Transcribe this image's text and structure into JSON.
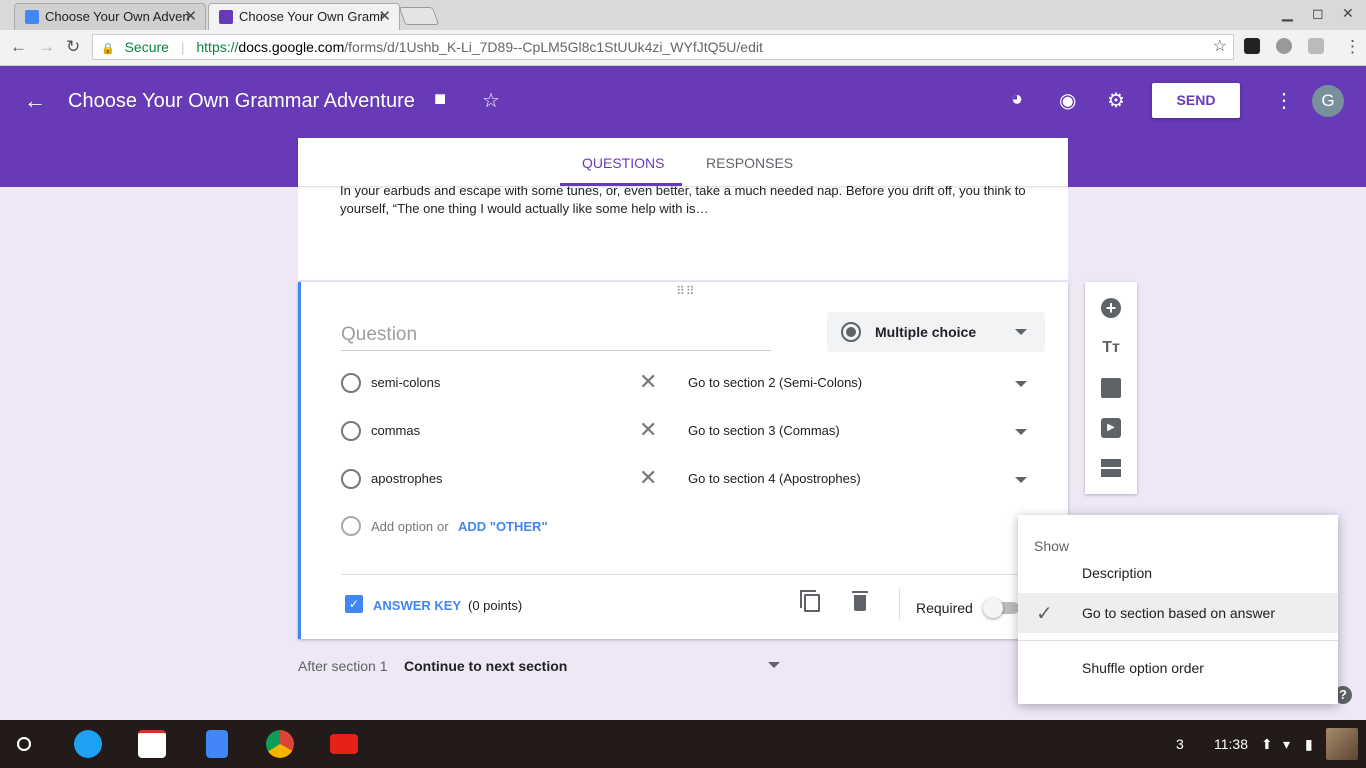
{
  "browser": {
    "tabs": [
      {
        "title": "Choose Your Own Adven",
        "active": false
      },
      {
        "title": "Choose Your Own Gramr",
        "active": true
      }
    ],
    "close_glyph": "✕",
    "secure_label": "Secure",
    "url_scheme": "https://",
    "url_host": "docs.google.com",
    "url_path": "/forms/d/1Ushb_K-Li_7D89--CpLM5Gl8c1StUUk4zi_WYfJtQ5U/edit"
  },
  "header": {
    "title": "Choose Your Own Grammar Adventure",
    "send_label": "SEND",
    "avatar_initial": "G",
    "accent": "#673ab7"
  },
  "tabs": {
    "questions": "QUESTIONS",
    "responses": "RESPONSES"
  },
  "description": {
    "text": "In your earbuds and escape with some tunes, or, even better, take a much needed nap. Before you drift off, you think to yourself, “The one thing I would actually like some help with is…"
  },
  "question": {
    "placeholder": "Question",
    "type": "Multiple choice",
    "options": [
      {
        "label": "semi-colons",
        "goto": "Go to section 2 (Semi-Colons)"
      },
      {
        "label": "commas",
        "goto": "Go to section 3 (Commas)"
      },
      {
        "label": "apostrophes",
        "goto": "Go to section 4 (Apostrophes)"
      }
    ],
    "add_option": "Add option",
    "or": "or",
    "add_other": "ADD \"OTHER\"",
    "answer_key": "ANSWER KEY",
    "points": "(0 points)",
    "required": "Required"
  },
  "after_section": {
    "label": "After section 1",
    "value": "Continue to next section"
  },
  "menu": {
    "header": "Show",
    "items": [
      {
        "label": "Description",
        "checked": false
      },
      {
        "label": "Go to section based on answer",
        "checked": true
      },
      {
        "label": "Shuffle option order",
        "checked": false
      }
    ]
  },
  "taskbar": {
    "notification_count": "3",
    "time": "11:38"
  }
}
